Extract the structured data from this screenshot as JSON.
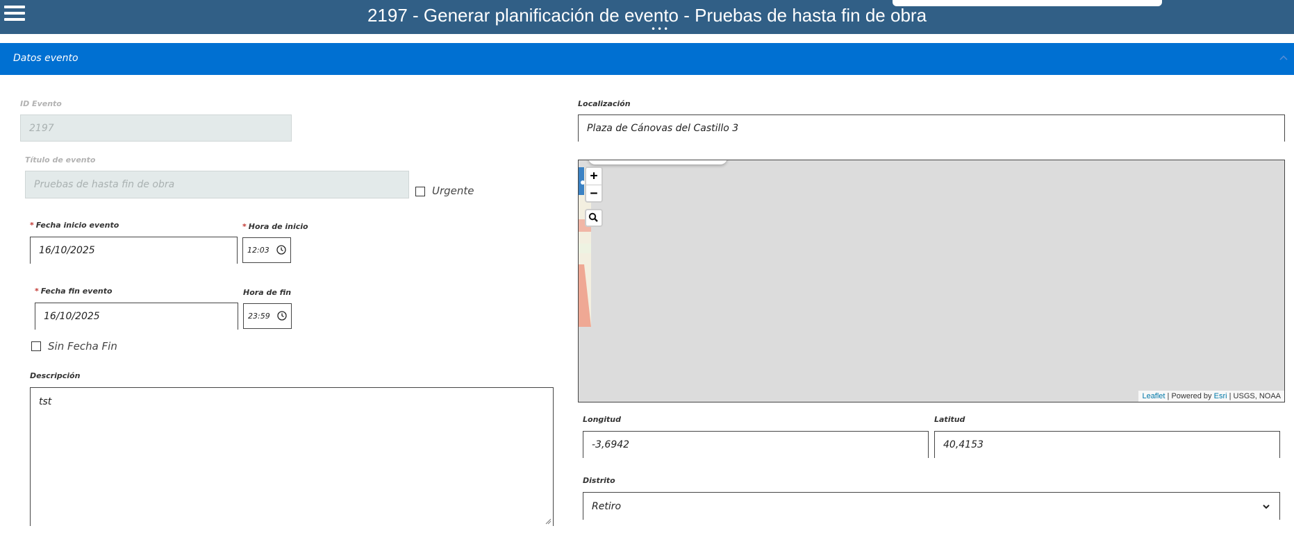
{
  "header": {
    "title": "2197 - Generar planificación de evento - Pruebas de hasta fin de obra",
    "menu_icon": "hamburger-menu-icon",
    "overflow_indicator": "•••"
  },
  "section": {
    "title": "Datos evento",
    "collapse_icon": "chevron-up-icon"
  },
  "form": {
    "id_evento": {
      "label": "ID Evento",
      "value": "2197"
    },
    "titulo": {
      "label": "Título de evento",
      "value": "Pruebas de hasta fin de obra"
    },
    "urgente": {
      "label": "Urgente",
      "checked": false
    },
    "fecha_inicio": {
      "label": "Fecha inicio evento",
      "required": "*",
      "value": "16/10/2025"
    },
    "hora_inicio": {
      "label": "Hora de inicio",
      "required": "*",
      "value": "12:03"
    },
    "fecha_fin": {
      "label": "Fecha fin evento",
      "required": "*",
      "value": "16/10/2025"
    },
    "hora_fin": {
      "label": "Hora de fin",
      "value": "23:59"
    },
    "sin_fecha_fin": {
      "label": "Sin Fecha Fin",
      "checked": false
    },
    "descripcion": {
      "label": "Descripción",
      "value": "tst"
    },
    "localizacion": {
      "label": "Localización",
      "value": "Plaza de Cánovas del Castillo 3"
    },
    "longitud": {
      "label": "Longitud",
      "value": "-3,6942"
    },
    "latitud": {
      "label": "Latitud",
      "value": "40,4153"
    },
    "distrito": {
      "label": "Distrito",
      "value": "Retiro"
    }
  },
  "map": {
    "zoom_in": "+",
    "zoom_out": "−",
    "attribution": {
      "leaflet": "Leaflet",
      "sep1": " | Powered by ",
      "esri": "Esri",
      "rest": " | USGS, NOAA"
    }
  },
  "colors": {
    "topbar": "#315f86",
    "section_header": "#0070d2",
    "required": "#c23934",
    "readonly_bg": "#e3eaea",
    "map_bg": "#dcdcdc"
  }
}
